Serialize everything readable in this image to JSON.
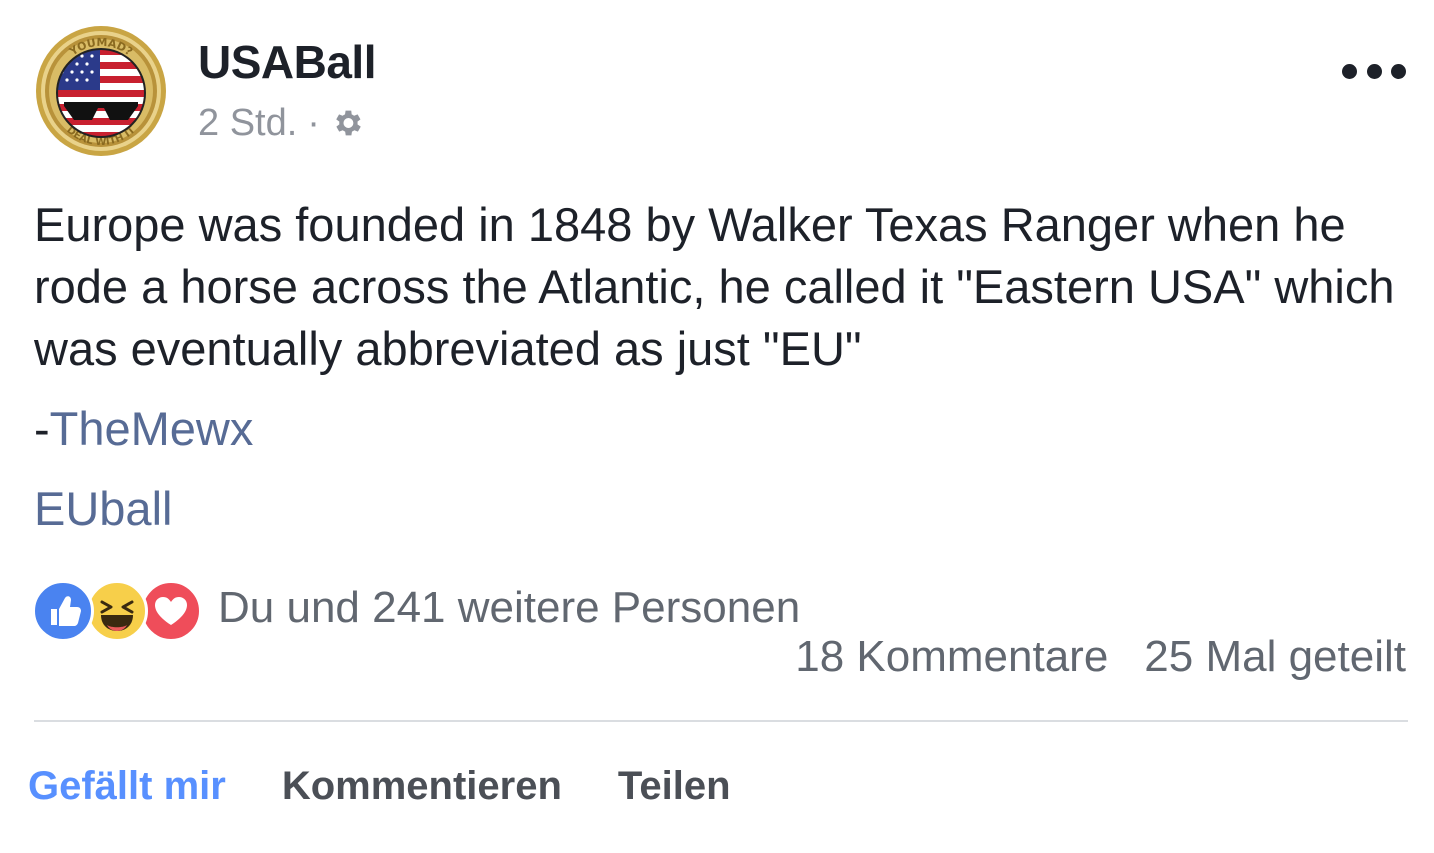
{
  "post": {
    "author": "USABall",
    "timestamp": "2 Std.",
    "separator": "·",
    "privacy_icon": "gear-icon",
    "more_icon": "more-dots-icon",
    "text": "Europe was founded in 1848 by Walker Texas Ranger when he rode a horse across the Atlantic, he called it \"Eastern USA\" which was eventually abbreviated as just \"EU\"",
    "attribution_prefix": "-",
    "attribution_name": "TheMewx",
    "hashtag": "EUball"
  },
  "avatar_badge_text": {
    "top": "YOUMAD?",
    "bottom": "DEAL WITH IT"
  },
  "reactions": {
    "types": [
      "like-icon",
      "haha-icon",
      "love-icon"
    ],
    "summary": "Du und 241 weitere Personen"
  },
  "counts": {
    "comments": "18 Kommentare",
    "shares": "25 Mal geteilt"
  },
  "actions": {
    "like": "Gefällt mir",
    "comment": "Kommentieren",
    "share": "Teilen"
  },
  "colors": {
    "link": "#576b95",
    "like_active": "#5890ff",
    "text": "#1d2129",
    "muted": "#90949c"
  }
}
